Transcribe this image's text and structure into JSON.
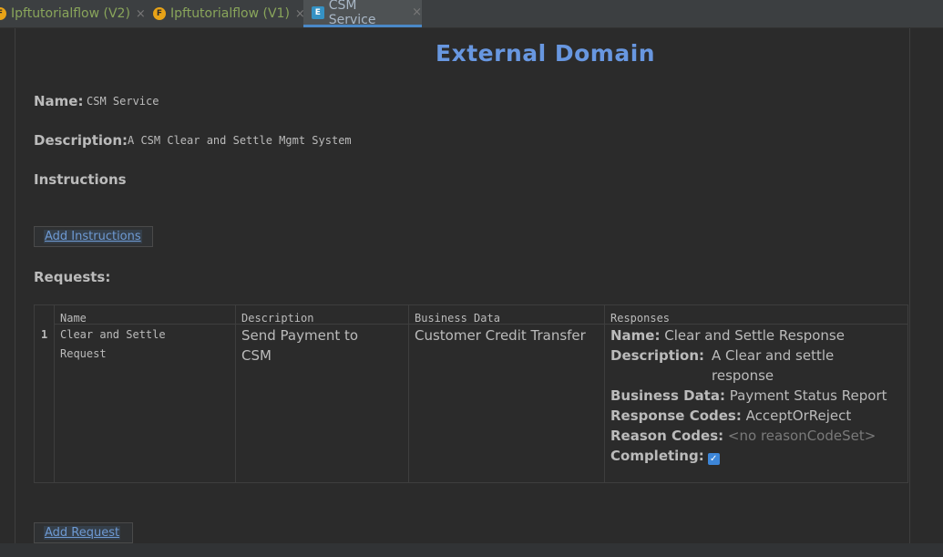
{
  "tabs": [
    {
      "label": "Ipftutorialflow (V2)",
      "badge": "F"
    },
    {
      "label": "Ipftutorialflow (V1)",
      "badge": "F"
    },
    {
      "label": "CSM Service",
      "badge": "E"
    }
  ],
  "close_glyph": "×",
  "title": "External Domain",
  "name": {
    "label": "Name:",
    "value": "CSM Service"
  },
  "description": {
    "label": "Description:",
    "value": "A CSM Clear and Settle Mgmt System"
  },
  "instructions_label": "Instructions",
  "add_instructions_label": "Add Instructions",
  "requests_label": "Requests:",
  "table": {
    "headers": [
      "Name",
      "Description",
      "Business Data",
      "Responses"
    ],
    "rows": [
      {
        "index": "1",
        "name_line1": "Clear and Settle",
        "name_line2": "Request",
        "desc_line1": "Send Payment to",
        "desc_line2": "CSM",
        "business_data": "Customer Credit Transfer",
        "response": {
          "name_label": "Name:",
          "name": "Clear and Settle Response",
          "desc_label": "Description:",
          "desc_line1": "A Clear and settle",
          "desc_line2": "response",
          "bd_label": "Business Data:",
          "bd": "Payment Status Report",
          "rc_label": "Response Codes:",
          "rc": "AcceptOrReject",
          "reason_label": "Reason Codes:",
          "reason": "<no reasonCodeSet>",
          "completing_label": "Completing:",
          "completing_check": "✓"
        }
      }
    ]
  },
  "add_request_label": "Add Request",
  "colors": {
    "accent": "#6897e0",
    "background": "#2b2b2b",
    "tab_active": "#4a88c7"
  }
}
